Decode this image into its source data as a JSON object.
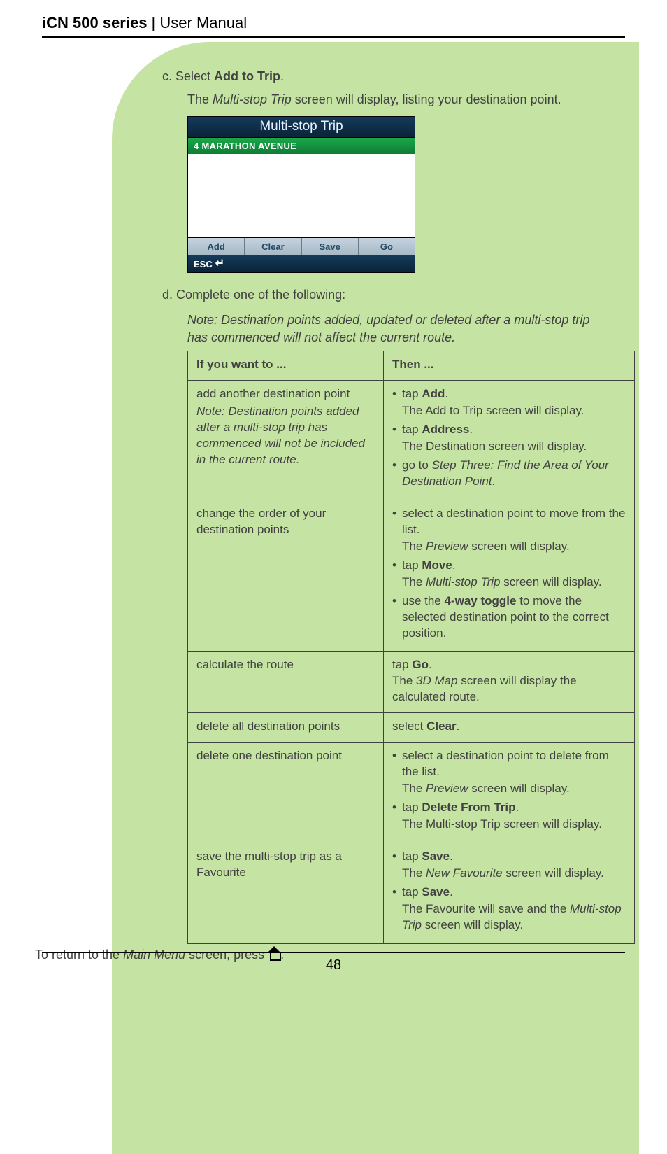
{
  "header": {
    "series": "iCN 500 series",
    "title_rest": " | User Manual"
  },
  "step_c": {
    "label": "c. Select ",
    "bold": "Add to Trip",
    "period": ".",
    "sub_pre": "The ",
    "sub_italic": "Multi-stop Trip",
    "sub_post": " screen will display, listing your destination point."
  },
  "device": {
    "title": "Multi-stop Trip",
    "row1": "4 MARATHON AVENUE",
    "buttons": [
      "Add",
      "Clear",
      "Save",
      "Go"
    ],
    "esc": "ESC"
  },
  "step_d": {
    "label": "d. Complete one of the following:"
  },
  "note": "Note: Destination points added, updated or deleted after a multi-stop trip has commenced will not affect the current route.",
  "table": {
    "head": [
      "If you want to ...",
      "Then ..."
    ],
    "rows": [
      {
        "left_main": "add another destination point",
        "left_note": "Note: Destination points added after a multi-stop trip has commenced will not be included in the current route.",
        "right": [
          {
            "pre": "tap ",
            "bold": "Add",
            "post": ".",
            "sub": "The Add to Trip screen will display."
          },
          {
            "pre": "tap ",
            "bold": "Address",
            "post": ".",
            "sub": "The Destination screen will display."
          },
          {
            "pre": "go to ",
            "italic": "Step Three: Find the Area of Your Destination Point",
            "post": "."
          }
        ]
      },
      {
        "left_main": "change the order of your destination points",
        "right": [
          {
            "pre": "select a destination point to move from the list.",
            "sub_pre": "The ",
            "sub_italic": "Preview",
            "sub_post": " screen will display."
          },
          {
            "pre": "tap ",
            "bold": "Move",
            "post": ".",
            "sub_pre": "The ",
            "sub_italic": "Multi-stop Trip",
            "sub_post": " screen will display."
          },
          {
            "pre": "use the ",
            "bold": "4-way toggle",
            "post": " to move the selected destination point to the correct position."
          }
        ]
      },
      {
        "left_main": "calculate the route",
        "right_plain": {
          "pre": "tap ",
          "bold": "Go",
          "post": ".",
          "sub_pre": "The ",
          "sub_italic": "3D Map",
          "sub_post": " screen will display the calculated route."
        }
      },
      {
        "left_main": "delete all destination points",
        "right_plain": {
          "pre": "select ",
          "bold": "Clear",
          "post": "."
        }
      },
      {
        "left_main": "delete one destination point",
        "right": [
          {
            "pre": "select a destination point to delete from the list.",
            "sub_pre": "The ",
            "sub_italic": "Preview",
            "sub_post": " screen will display."
          },
          {
            "pre": "tap ",
            "bold": "Delete From Trip",
            "post": ".",
            "sub": "The Multi-stop Trip screen will display."
          }
        ]
      },
      {
        "left_main": "save the multi-stop trip as a Favourite",
        "right": [
          {
            "pre": "tap ",
            "bold": "Save",
            "post": ".",
            "sub_pre": "The ",
            "sub_italic": "New Favourite",
            "sub_post": " screen will display."
          },
          {
            "pre": "tap ",
            "bold": "Save",
            "post": ".",
            "sub_mix_pre": "The Favourite will save and the ",
            "sub_mix_italic": "Multi-stop Trip",
            "sub_mix_post": " screen will display."
          }
        ]
      }
    ]
  },
  "return": {
    "pre": "To return to the ",
    "italic": "Main Menu",
    "post": " screen, press ",
    "end": "."
  },
  "footer": {
    "page": "48"
  }
}
